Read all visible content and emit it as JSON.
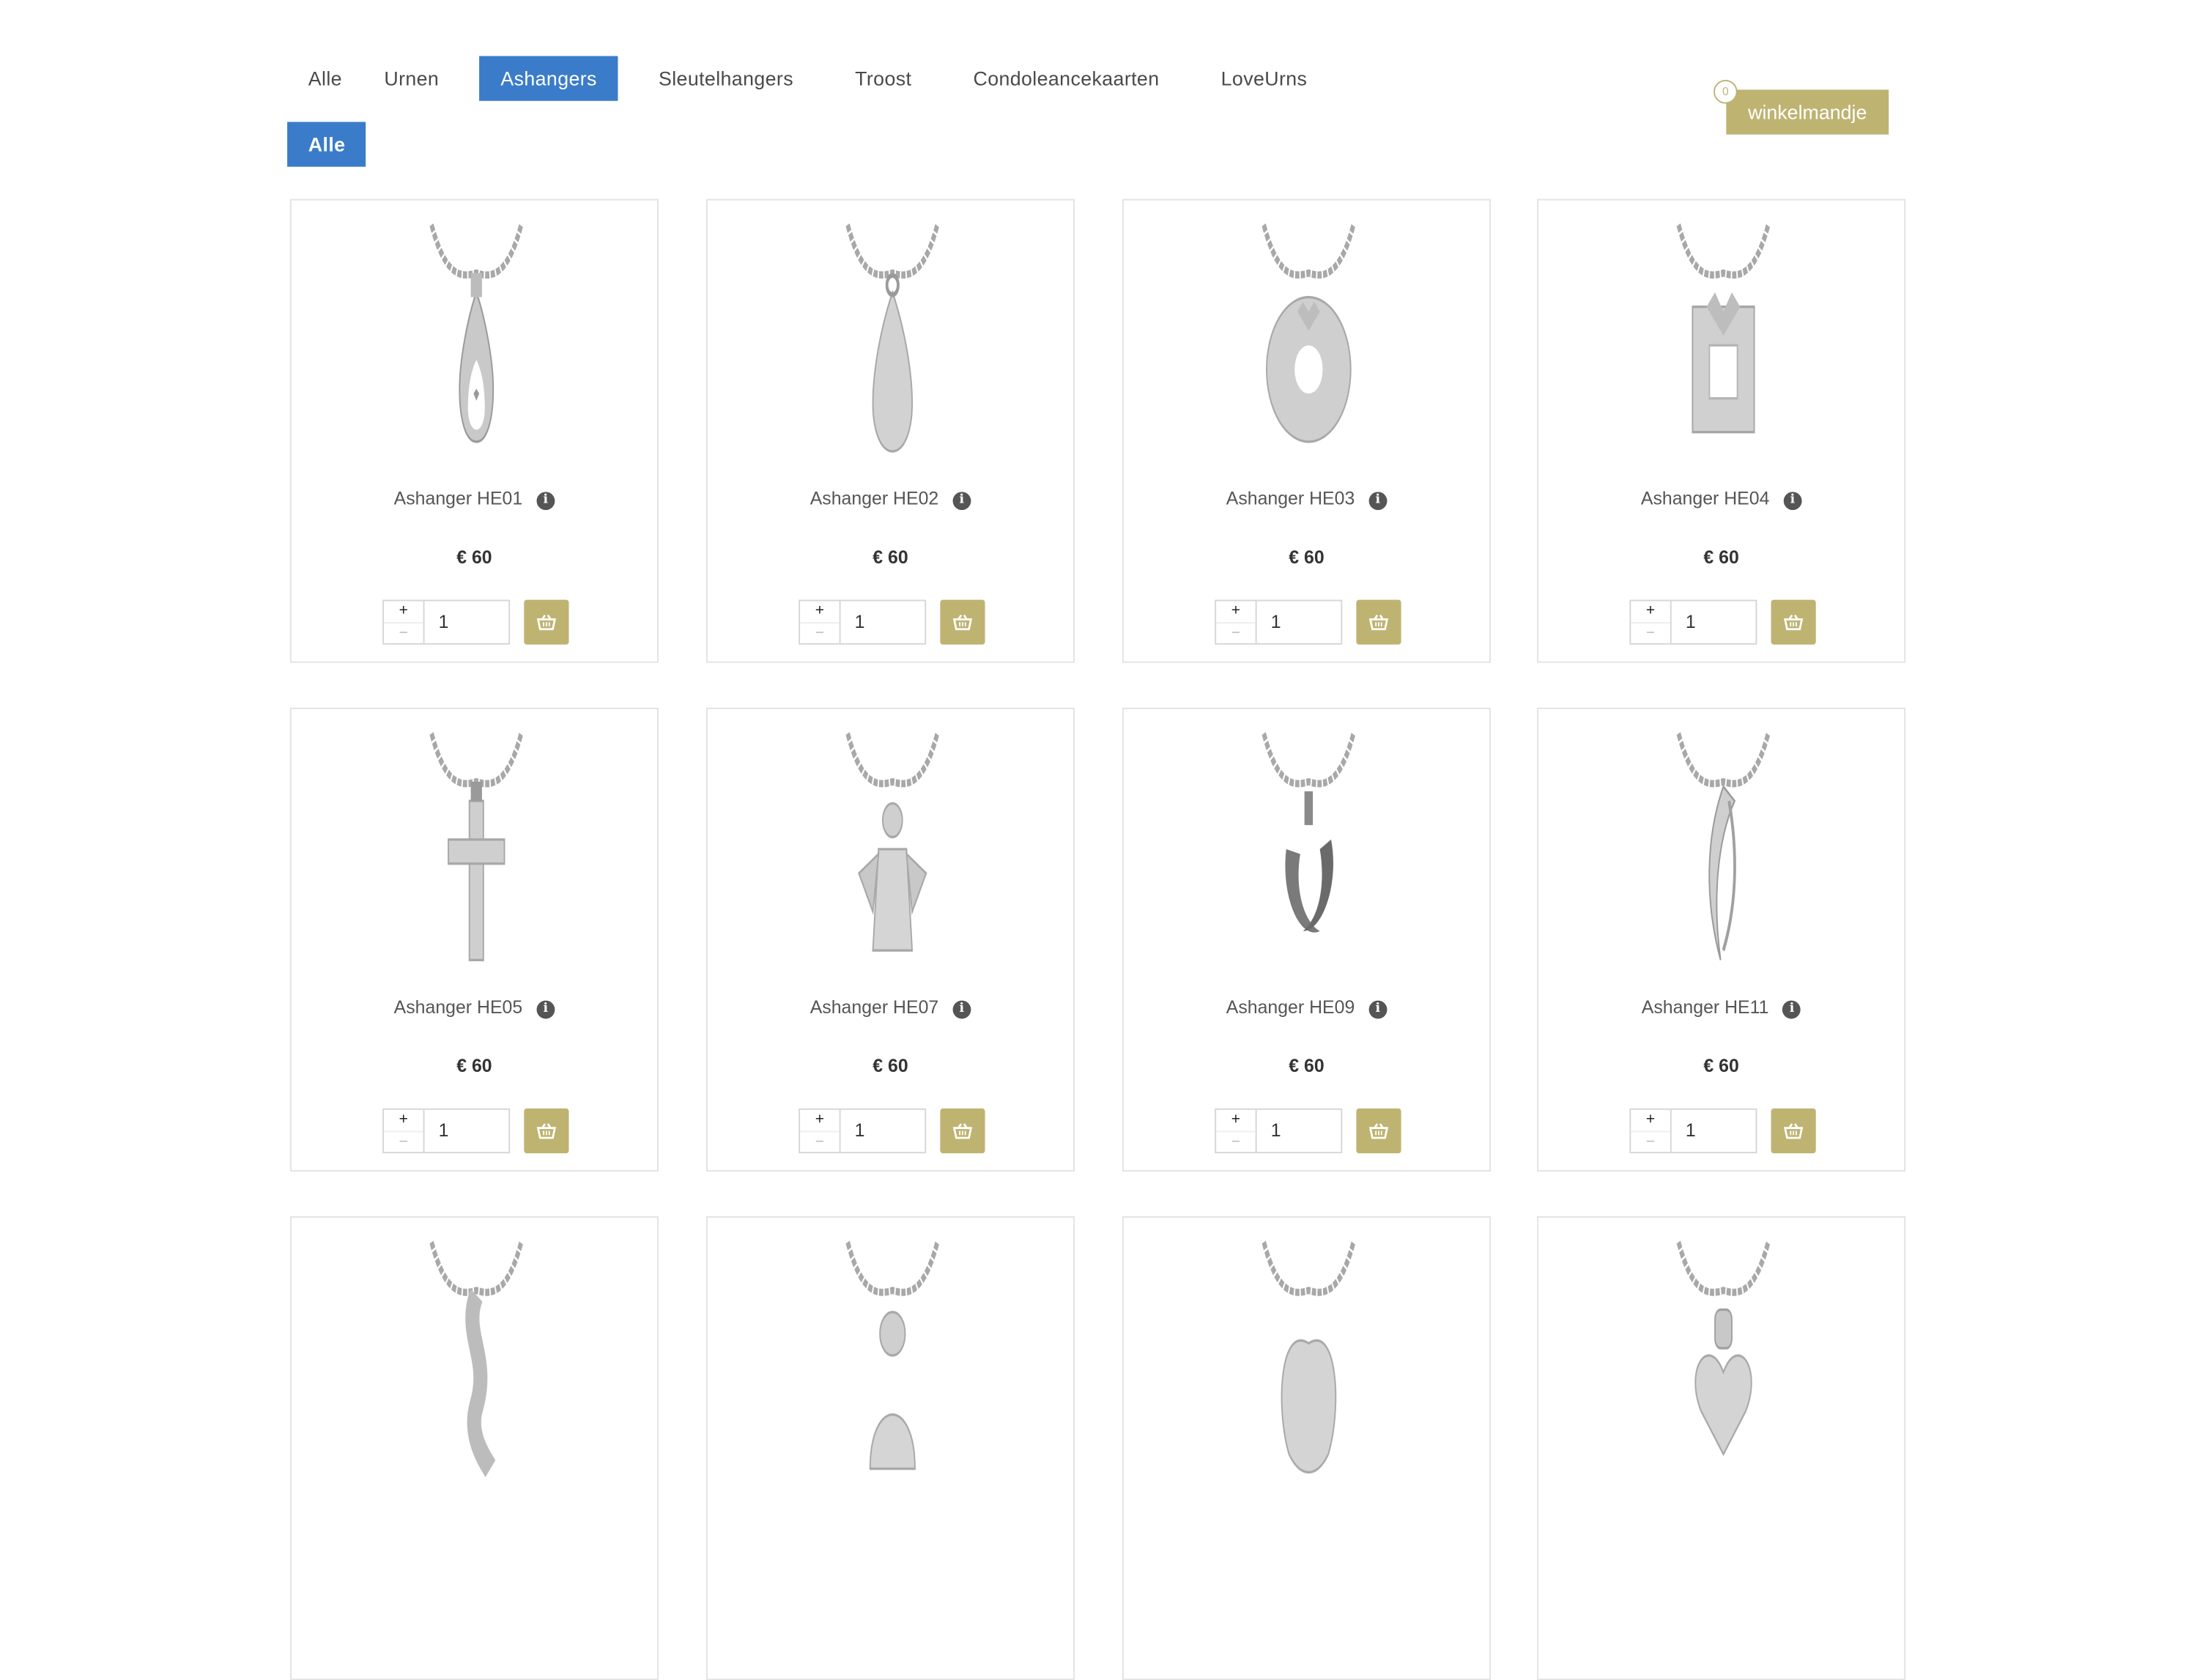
{
  "nav": {
    "tabs": [
      {
        "label": "Alle",
        "active": false
      },
      {
        "label": "Urnen",
        "active": false
      },
      {
        "label": "Ashangers",
        "active": true
      },
      {
        "label": "Sleutelhangers",
        "active": false
      },
      {
        "label": "Troost",
        "active": false
      },
      {
        "label": "Condoleancekaarten",
        "active": false
      },
      {
        "label": "LoveUrns",
        "active": false
      }
    ],
    "subtabs": [
      {
        "label": "Alle",
        "active": true
      }
    ]
  },
  "cart": {
    "label": "winkelmandje",
    "count": "0"
  },
  "products": [
    {
      "name": "Ashanger HE01",
      "price": "€ 60",
      "qty": "1",
      "shape": "drop-heart"
    },
    {
      "name": "Ashanger HE02",
      "price": "€ 60",
      "qty": "1",
      "shape": "teardrop"
    },
    {
      "name": "Ashanger HE03",
      "price": "€ 60",
      "qty": "1",
      "shape": "heart-wreath"
    },
    {
      "name": "Ashanger HE04",
      "price": "€ 60",
      "qty": "1",
      "shape": "square-frame"
    },
    {
      "name": "Ashanger HE05",
      "price": "€ 60",
      "qty": "1",
      "shape": "cross"
    },
    {
      "name": "Ashanger HE07",
      "price": "€ 60",
      "qty": "1",
      "shape": "angel"
    },
    {
      "name": "Ashanger HE09",
      "price": "€ 60",
      "qty": "1",
      "shape": "dolphins"
    },
    {
      "name": "Ashanger HE11",
      "price": "€ 60",
      "qty": "1",
      "shape": "twisted-drop"
    },
    {
      "name": "",
      "price": "",
      "qty": "",
      "shape": "swirl"
    },
    {
      "name": "",
      "price": "",
      "qty": "",
      "shape": "mother-child"
    },
    {
      "name": "",
      "price": "",
      "qty": "",
      "shape": "apple"
    },
    {
      "name": "",
      "price": "",
      "qty": "",
      "shape": "heart"
    }
  ],
  "icons": {
    "info": "info-icon",
    "basket": "basket-icon"
  },
  "colors": {
    "accent": "#3a7cc9",
    "cart": "#bfb372"
  }
}
